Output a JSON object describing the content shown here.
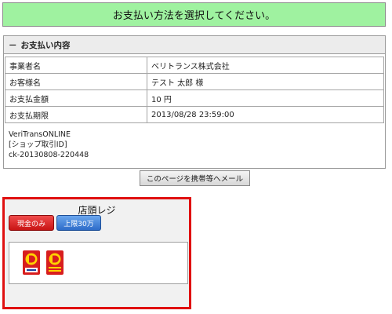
{
  "banner": {
    "text": "お支払い方法を選択してください。"
  },
  "payment_details": {
    "heading": "お支払い内容",
    "rows": [
      {
        "label": "事業者名",
        "value": "ベリトランス株式会社"
      },
      {
        "label": "お客様名",
        "value": "テスト 太郎 様"
      },
      {
        "label": "お支払金額",
        "value": "10 円"
      },
      {
        "label": "お支払期限",
        "value": "2013/08/28 23:59:00"
      }
    ],
    "ref_lines": [
      "VeriTransONLINE",
      "[ショップ取引ID]",
      "ck-20130808-220448"
    ]
  },
  "mail_button": {
    "label": "このページを携帯等へメール"
  },
  "store": {
    "title": "店頭レジ",
    "filters": [
      {
        "label": "現金のみ",
        "color": "#d81e1e"
      },
      {
        "label": "上限30万",
        "color": "#3b78d4"
      }
    ],
    "logos": [
      "daily-yamazaki-icon",
      "yamazaki-daily-store-icon"
    ]
  },
  "colors": {
    "banner_bg": "#9ff2a0",
    "store_border": "#e01010",
    "logo_red": "#d81e1e"
  }
}
